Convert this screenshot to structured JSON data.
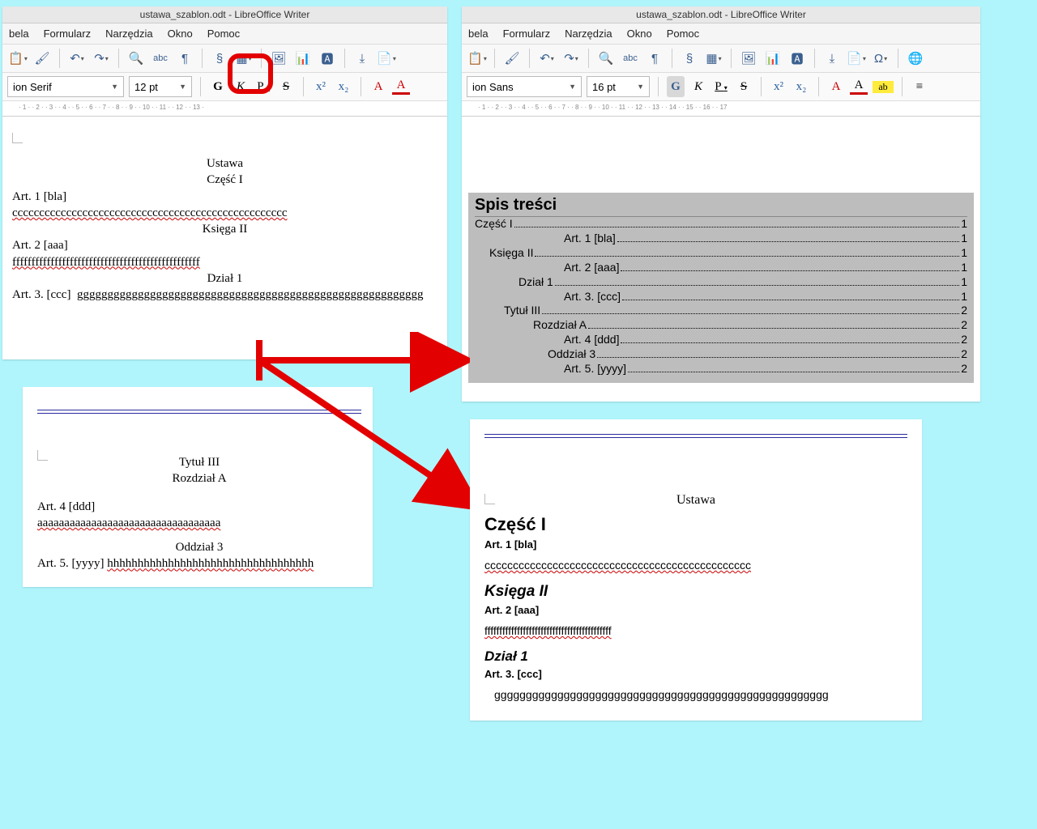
{
  "title": "ustawa_szablon.odt - LibreOffice Writer",
  "menus": [
    "bela",
    "Formularz",
    "Narzędzia",
    "Okno",
    "Pomoc"
  ],
  "left": {
    "font": "ion Serif",
    "size": "12 pt",
    "doc": {
      "l1": "Ustawa",
      "l2": "Część I",
      "art1": "Art. 1 [bla]",
      "c": "ccccccccccccccccccccccccccccccccccccccccccccccccccc",
      "ks": "Księga II",
      "art2": "Art. 2 [aaa]",
      "f": "fffffffffffffffffffffffffffffffffffffffffffffffff",
      "dz": "Dział 1",
      "art3": "Art. 3.  [ccc]",
      "g": "ggggggggggggggggggggggggggggggggggggggggggggggggggggggggg"
    }
  },
  "right": {
    "font": "ion Sans",
    "size": "16 pt",
    "toc_title": "Spis treści",
    "toc": [
      {
        "label": "Część I",
        "indent": 0,
        "page": "1"
      },
      {
        "label": "Art. 1 [bla]",
        "indent": 110,
        "page": "1"
      },
      {
        "label": "Księga II",
        "indent": 18,
        "page": "1"
      },
      {
        "label": "Art. 2 [aaa]",
        "indent": 110,
        "page": "1"
      },
      {
        "label": "Dział 1",
        "indent": 54,
        "page": "1"
      },
      {
        "label": "Art. 3. [ccc]",
        "indent": 110,
        "page": "1"
      },
      {
        "label": "Tytuł III",
        "indent": 36,
        "page": "2"
      },
      {
        "label": "Rozdział A",
        "indent": 72,
        "page": "2"
      },
      {
        "label": "Art. 4 [ddd]",
        "indent": 110,
        "page": "2"
      },
      {
        "label": "Oddział 3",
        "indent": 90,
        "page": "2"
      },
      {
        "label": "Art. 5. [yyyy]",
        "indent": 110,
        "page": "2"
      }
    ]
  },
  "frag": {
    "tyt": "Tytuł III",
    "roz": "Rozdział A",
    "art4": "Art. 4 [ddd]",
    "a": "aaaaaaaaaaaaaaaaaaaaaaaaaaaaaaaaaa",
    "odd": "Oddział 3",
    "art5p": "Art. 5. [yyyy]",
    "h": "hhhhhhhhhhhhhhhhhhhhhhhhhhhhhhhhhh"
  },
  "doc2": {
    "u": "Ustawa",
    "h1": "Część I",
    "a1": "Art. 1 [bla]",
    "c": "ccccccccccccccccccccccccccccccccccccccccccccccc",
    "h2": "Księga II",
    "a2": "Art. 2 [aaa]",
    "f": "fffffffffffffffffffffffffffffffffffffffffff",
    "h3": "Dział 1",
    "a3": "Art. 3.  [ccc]",
    "g": "ggggggggggggggggggggggggggggggggggggggggggggggggggggg"
  },
  "icons": {
    "paste": "📋",
    "brush": "🖌",
    "undo": "↶",
    "redo": "↷",
    "find": "🔍",
    "spell": "abc",
    "pilcrow": "¶",
    "para": "§",
    "table": "▦",
    "image": "🖼",
    "chart": "📊",
    "textbox": "🅰",
    "pgbrk": "⤓",
    "field": "📄",
    "omega": "Ω",
    "globe": "🌐",
    "bold": "G",
    "italic": "K",
    "uline": "P",
    "strike": "S",
    "sup": "x²",
    "sub": "x₂",
    "clearA": "A",
    "colorA": "A",
    "hilite": "ab",
    "align": "≡"
  }
}
